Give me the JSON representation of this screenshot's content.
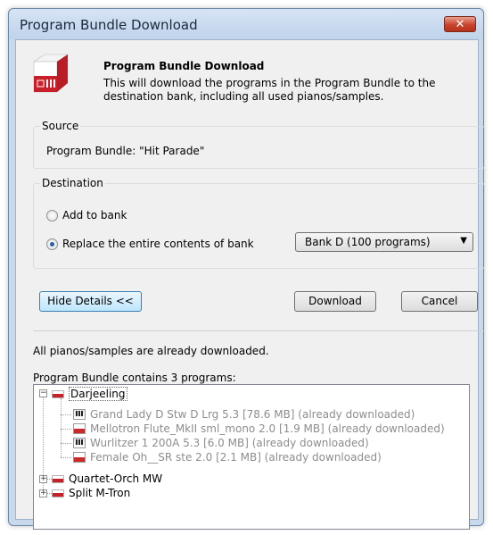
{
  "window": {
    "title": "Program Bundle Download",
    "close_glyph": "✕"
  },
  "header": {
    "title": "Program Bundle Download",
    "description": "This will download the programs in the Program Bundle to the destination bank, including all used pianos/samples."
  },
  "source": {
    "label": "Source",
    "text": "Program Bundle: \"Hit Parade\""
  },
  "destination": {
    "label": "Destination",
    "options": [
      {
        "label": "Add to bank",
        "checked": false
      },
      {
        "label": "Replace the entire contents of bank",
        "checked": true
      }
    ],
    "bank_select": {
      "value": "Bank D (100 programs)",
      "arrow": "▼"
    }
  },
  "buttons": {
    "hide_details": "Hide Details <<",
    "download": "Download",
    "cancel": "Cancel"
  },
  "details": {
    "status": "All pianos/samples are already downloaded.",
    "contains": "Program Bundle contains 3 programs:"
  },
  "tree": {
    "programs": [
      {
        "name": "Darjeeling",
        "expanded": true,
        "children": [
          {
            "type": "piano-icon",
            "text": "Grand Lady D   Stw D  Lrg 5.3 [78.6 MB] (already downloaded)"
          },
          {
            "type": "sample-icon",
            "text": "Mellotron Flute_MkII sml_mono 2.0 [1.9 MB] (already downloaded)"
          },
          {
            "type": "piano-icon",
            "text": "Wurlitzer 1 200A 5.3 [6.0 MB] (already downloaded)"
          },
          {
            "type": "sample-icon",
            "text": "Female Oh__SR ste 2.0 [2.1 MB] (already downloaded)"
          }
        ]
      },
      {
        "name": "Quartet-Orch  MW",
        "expanded": false
      },
      {
        "name": "Split M-Tron",
        "expanded": false
      }
    ],
    "expand_glyph": "+",
    "collapse_glyph": "−"
  },
  "colors": {
    "accent": "#c8202a",
    "frame": "#c9d9ec",
    "focus": "#3c7fb1"
  }
}
